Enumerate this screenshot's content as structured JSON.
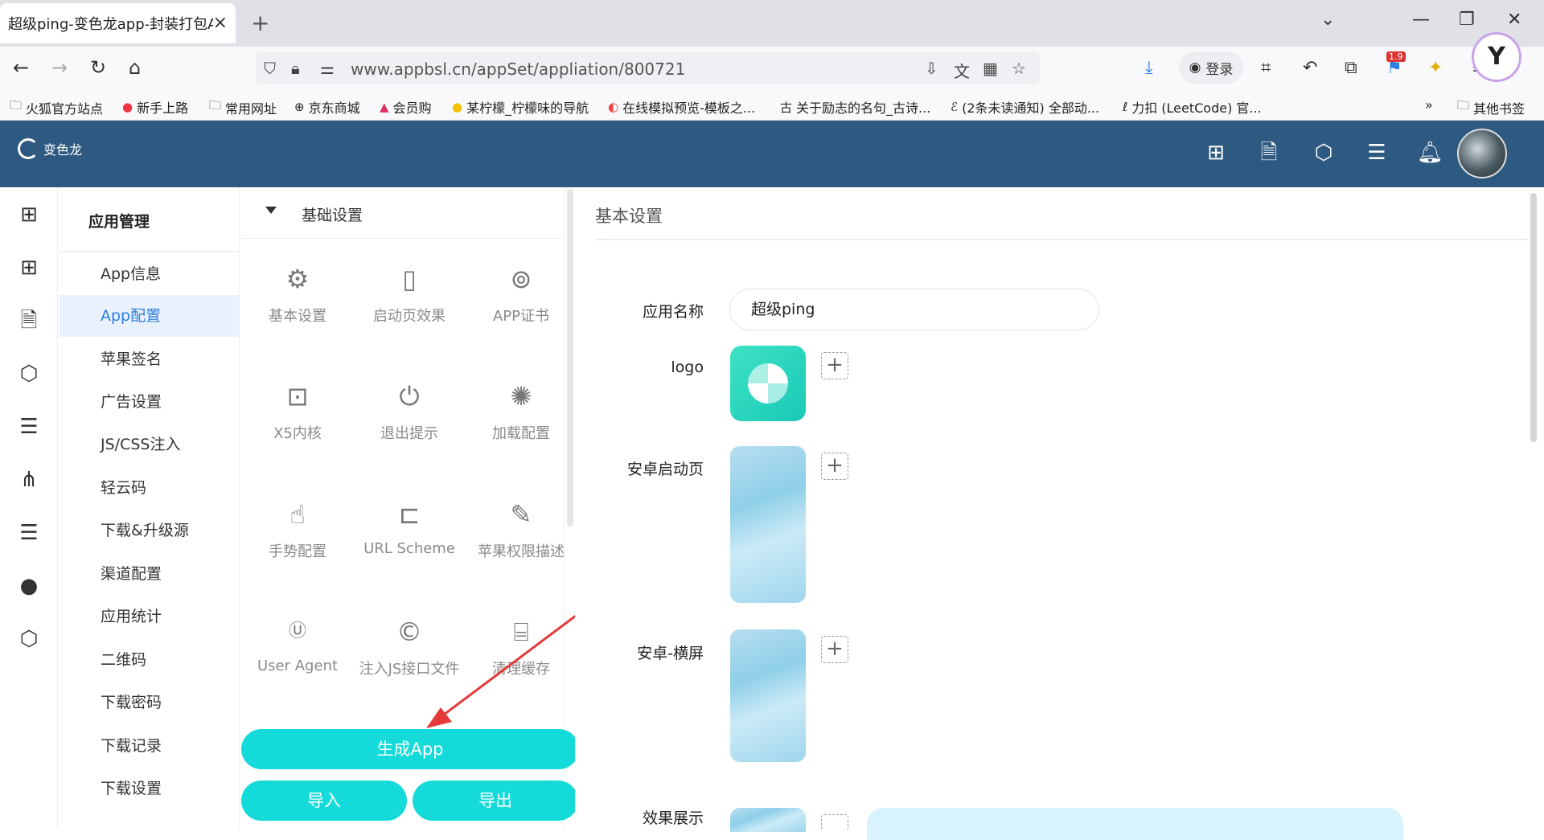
{
  "browser": {
    "tab_title": "超级ping-变色龙app-封装打包App",
    "url": "www.appbsl.cn/appSet/appliation/800721",
    "login_label": "登录",
    "badge": "1.9",
    "bookmarks": [
      "火狐官方站点",
      "新手上路",
      "常用网址",
      "京东商城",
      "会员购",
      "某柠檬_柠檬味的导航",
      "在线模拟预览-模板之...",
      "关于励志的名句_古诗...",
      "(2条未读通知) 全部动...",
      "力扣 (LeetCode) 官...",
      "其他书签"
    ]
  },
  "app": {
    "brand": "变色龙",
    "colors": {
      "header": "#2e5a82",
      "accent": "#15dada",
      "active": "#2f7fe0"
    }
  },
  "menu": {
    "title": "应用管理",
    "items": [
      "App信息",
      "App配置",
      "苹果签名",
      "广告设置",
      "JS/CSS注入",
      "轻云码",
      "下载&升级源",
      "渠道配置",
      "应用统计",
      "二维码",
      "下载密码",
      "下载记录",
      "下载设置"
    ],
    "active": "App配置"
  },
  "panel": {
    "title": "基础设置",
    "items": [
      {
        "label": "基本设置",
        "icon": "gear-icon"
      },
      {
        "label": "启动页效果",
        "icon": "image-icon"
      },
      {
        "label": "APP证书",
        "icon": "medal-icon"
      },
      {
        "label": "X5内核",
        "icon": "chip-icon"
      },
      {
        "label": "退出提示",
        "icon": "power-icon"
      },
      {
        "label": "加载配置",
        "icon": "loading-icon"
      },
      {
        "label": "手势配置",
        "icon": "hand-icon"
      },
      {
        "label": "URL Scheme",
        "icon": "scheme-icon"
      },
      {
        "label": "苹果权限描述",
        "icon": "edit-doc-icon"
      },
      {
        "label": "User Agent",
        "icon": "ua-icon"
      },
      {
        "label": "注入JS接口文件",
        "icon": "copyright-icon"
      },
      {
        "label": "清理缓存",
        "icon": "broom-icon"
      }
    ],
    "generate": "生成App",
    "import": "导入",
    "export": "导出"
  },
  "form": {
    "title": "基本设置",
    "app_name_label": "应用名称",
    "app_name_value": "超级ping",
    "logo_label": "logo",
    "android_splash_label": "安卓启动页",
    "android_landscape_label": "安卓-横屏",
    "preview_label": "效果展示"
  }
}
